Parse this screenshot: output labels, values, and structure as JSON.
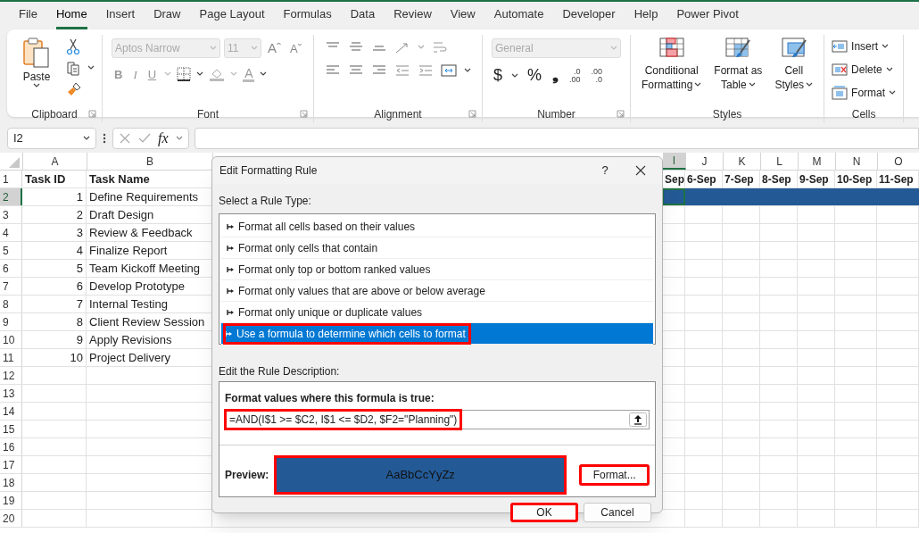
{
  "menu_tabs": [
    {
      "label": "File",
      "selected": false
    },
    {
      "label": "Home",
      "selected": true
    },
    {
      "label": "Insert",
      "selected": false
    },
    {
      "label": "Draw",
      "selected": false
    },
    {
      "label": "Page Layout",
      "selected": false
    },
    {
      "label": "Formulas",
      "selected": false
    },
    {
      "label": "Data",
      "selected": false
    },
    {
      "label": "Review",
      "selected": false
    },
    {
      "label": "View",
      "selected": false
    },
    {
      "label": "Automate",
      "selected": false
    },
    {
      "label": "Developer",
      "selected": false
    },
    {
      "label": "Help",
      "selected": false
    },
    {
      "label": "Power Pivot",
      "selected": false
    }
  ],
  "ribbon": {
    "clipboard": {
      "label": "Clipboard",
      "paste": "Paste"
    },
    "font": {
      "label": "Font",
      "font_name": "Aptos Narrow",
      "font_size": "11",
      "disabled": true,
      "grow": "Aˆ",
      "shrink": "Aˇ",
      "bold": "B",
      "italic": "I",
      "underline": "U",
      "font_color": "A"
    },
    "alignment": {
      "label": "Alignment"
    },
    "number": {
      "label": "Number",
      "format": "General",
      "disabled": true,
      "currency": "$",
      "percent": "%",
      "comma": "❟",
      "increase_decimal": [
        ".0",
        ".00"
      ],
      "decrease_decimal": [
        ".00",
        ".0"
      ]
    },
    "styles": {
      "label": "Styles",
      "buttons": [
        {
          "kind": "conditional",
          "lines": [
            "Conditional",
            "Formatting"
          ]
        },
        {
          "kind": "table",
          "lines": [
            "Format as",
            "Table"
          ]
        },
        {
          "kind": "cellstyles",
          "lines": [
            "Cell",
            "Styles"
          ]
        }
      ]
    },
    "cells": {
      "label": "Cells",
      "buttons": [
        {
          "kind": "insert",
          "label": "Insert"
        },
        {
          "kind": "delete",
          "label": "Delete"
        },
        {
          "kind": "format",
          "label": "Format"
        }
      ]
    }
  },
  "formula_bar": {
    "name_box": "I2",
    "fx": "fx"
  },
  "grid": {
    "columns": [
      {
        "header": "A",
        "selected": false
      },
      {
        "header": "B",
        "selected": false
      },
      {
        "header": "I",
        "selected": true
      },
      {
        "header": "J",
        "selected": false
      },
      {
        "header": "K",
        "selected": false
      },
      {
        "header": "L",
        "selected": false
      },
      {
        "header": "M",
        "selected": false
      },
      {
        "header": "N",
        "selected": false
      },
      {
        "header": "O",
        "selected": false
      }
    ],
    "rows": [
      {
        "number": "1",
        "selected": false,
        "formatted": false,
        "task_id": "Task ID",
        "task_name": "Task Name",
        "dates": [
          "Sep",
          "6-Sep",
          "7-Sep",
          "8-Sep",
          "9-Sep",
          "10-Sep",
          "11-Sep"
        ]
      },
      {
        "number": "2",
        "selected": true,
        "formatted": true,
        "task_id": "1",
        "task_name": "Define Requirements"
      },
      {
        "number": "3",
        "selected": false,
        "formatted": false,
        "task_id": "2",
        "task_name": "Draft Design"
      },
      {
        "number": "4",
        "selected": false,
        "formatted": false,
        "task_id": "3",
        "task_name": "Review & Feedback"
      },
      {
        "number": "5",
        "selected": false,
        "formatted": false,
        "task_id": "4",
        "task_name": "Finalize Report"
      },
      {
        "number": "6",
        "selected": false,
        "formatted": false,
        "task_id": "5",
        "task_name": "Team Kickoff Meeting"
      },
      {
        "number": "7",
        "selected": false,
        "formatted": false,
        "task_id": "6",
        "task_name": "Develop Prototype"
      },
      {
        "number": "8",
        "selected": false,
        "formatted": false,
        "task_id": "7",
        "task_name": "Internal Testing"
      },
      {
        "number": "9",
        "selected": false,
        "formatted": false,
        "task_id": "8",
        "task_name": "Client Review Session"
      },
      {
        "number": "10",
        "selected": false,
        "formatted": false,
        "task_id": "9",
        "task_name": "Apply Revisions"
      },
      {
        "number": "11",
        "selected": false,
        "formatted": false,
        "task_id": "10",
        "task_name": "Project Delivery"
      },
      {
        "number": "12",
        "selected": false,
        "formatted": false
      },
      {
        "number": "13",
        "selected": false,
        "formatted": false
      },
      {
        "number": "14",
        "selected": false,
        "formatted": false
      },
      {
        "number": "15",
        "selected": false,
        "formatted": false
      },
      {
        "number": "16",
        "selected": false,
        "formatted": false
      },
      {
        "number": "17",
        "selected": false,
        "formatted": false
      },
      {
        "number": "18",
        "selected": false,
        "formatted": false
      },
      {
        "number": "19",
        "selected": false,
        "formatted": false
      },
      {
        "number": "20",
        "selected": false,
        "formatted": false
      }
    ]
  },
  "dialog": {
    "title": "Edit Formatting Rule",
    "help": "?",
    "select_label": "Select a Rule Type:",
    "rule_types": [
      {
        "label": "Format all cells based on their values",
        "selected": false,
        "highlighted": false
      },
      {
        "label": "Format only cells that contain",
        "selected": false,
        "highlighted": false
      },
      {
        "label": "Format only top or bottom ranked values",
        "selected": false,
        "highlighted": false
      },
      {
        "label": "Format only values that are above or below average",
        "selected": false,
        "highlighted": false
      },
      {
        "label": "Format only unique or duplicate values",
        "selected": false,
        "highlighted": false
      },
      {
        "label": "Use a formula to determine which cells to format",
        "selected": true,
        "highlighted": true
      }
    ],
    "description_label": "Edit the Rule Description:",
    "formula_label": "Format values where this formula is true:",
    "formula": {
      "value": "=AND(I$1 >= $C2, I$1 <= $D2, $F2=\"Planning\")",
      "highlighted": true
    },
    "preview_label": "Preview:",
    "preview": {
      "sample": "AaBbCcYyZz",
      "color": "#235a96",
      "highlighted": true
    },
    "format_button": {
      "label": "Format...",
      "highlighted": true
    },
    "ok_button": {
      "label": "OK",
      "highlighted": true
    },
    "cancel_button": {
      "label": "Cancel",
      "highlighted": false
    }
  }
}
